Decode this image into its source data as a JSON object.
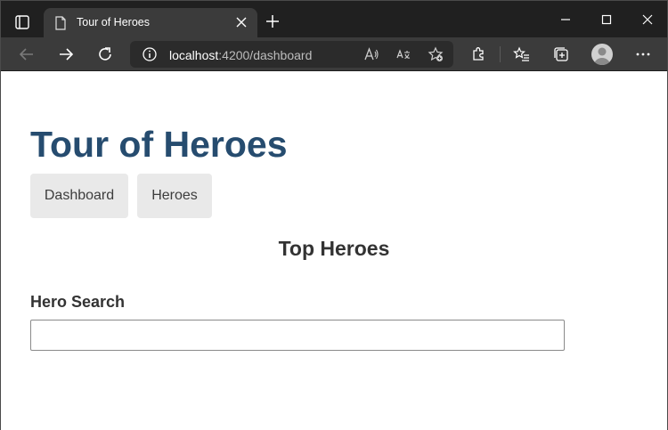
{
  "browser": {
    "tab_title": "Tour of Heroes",
    "url_host": "localhost",
    "url_rest": ":4200/dashboard",
    "icons": [
      "tab-actions-icon",
      "page-icon",
      "close-icon",
      "plus-icon",
      "minimize-icon",
      "maximize-icon",
      "window-close-icon",
      "back-icon",
      "forward-icon",
      "refresh-icon",
      "info-icon",
      "read-aloud-icon",
      "translate-icon",
      "add-favorite-icon",
      "extensions-icon",
      "favorites-icon",
      "collections-icon",
      "profile-icon",
      "more-icon"
    ]
  },
  "app": {
    "title": "Tour of Heroes",
    "nav": {
      "dashboard": "Dashboard",
      "heroes": "Heroes"
    },
    "top_heroes_title": "Top Heroes",
    "search": {
      "label": "Hero Search",
      "value": ""
    }
  },
  "colors": {
    "title": "#264c6f",
    "nav_bg": "#e9e9e9",
    "chrome_dark": "#202020",
    "chrome_toolbar": "#3b3b3b"
  }
}
